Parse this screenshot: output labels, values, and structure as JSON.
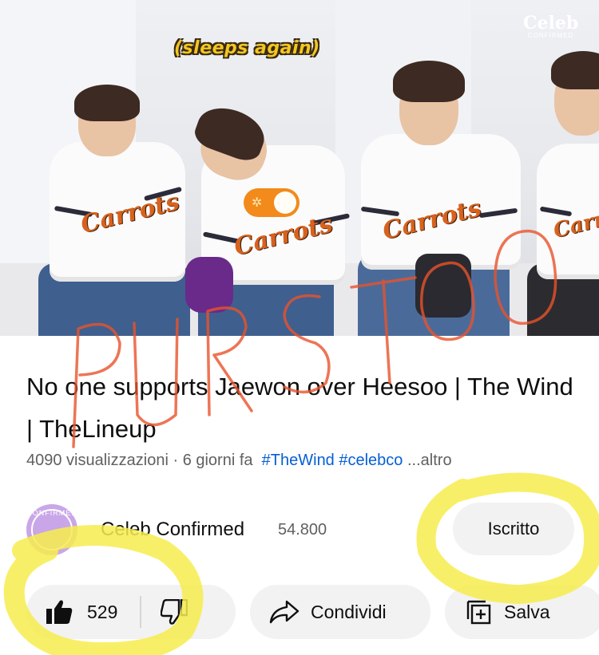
{
  "video": {
    "caption": "(sleeps again)",
    "logo_line1": "Celeb",
    "logo_line2": "CONFIRMED",
    "jersey_text": "Carrots"
  },
  "overlay_scribble_text": "PURSTOO",
  "title": "No one supports Jaewon over Heesoo | The Wind | TheLineup",
  "meta": {
    "views": "4090 visualizzazioni",
    "separator": "·",
    "age": "6 giorni fa",
    "hashtags": "#TheWind #celebco",
    "more": "...altro"
  },
  "channel": {
    "name": "Celeb Confirmed",
    "subscribers": "54.800",
    "avatar_text": "CONFIRMED",
    "subscribe_label": "Iscritto"
  },
  "actions": {
    "likes": "529",
    "share_label": "Condividi",
    "save_label": "Salva"
  },
  "colors": {
    "link": "#065fd4",
    "secondary_text": "#606060",
    "pill_bg": "#f2f2f2",
    "scribble_red": "#e8532b",
    "highlight_yellow": "#f7ec4d"
  },
  "icons": [
    "thumbs-up-icon",
    "thumbs-down-icon",
    "share-arrow-icon",
    "save-playlist-icon"
  ]
}
